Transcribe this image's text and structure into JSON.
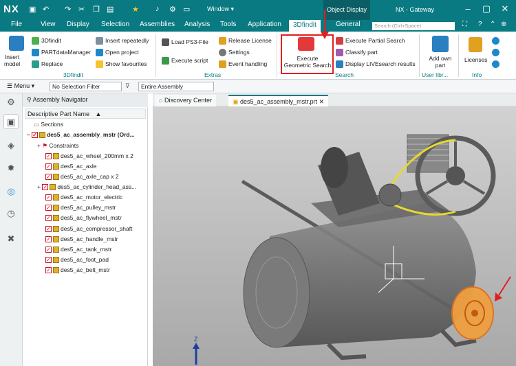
{
  "app": {
    "logo": "NX",
    "window_menu": "Window",
    "context_tab": "Object Display",
    "title": "NX - Gateway"
  },
  "menu": {
    "items": [
      "File",
      "View",
      "Display",
      "Selection",
      "Assemblies",
      "Analysis",
      "Tools",
      "Application",
      "3Dfindit",
      "General"
    ],
    "search_placeholder": "Search (Ctrl+Space)"
  },
  "ribbon": {
    "find": {
      "insert_model": "Insert\nmodel",
      "threedfindit": "3Dfindit",
      "partdata": "PARTdataManager",
      "replace": "Replace",
      "insert_rep": "Insert repeatedly",
      "open_project": "Open project",
      "show_fav": "Show favourites",
      "group": "3Dfindit"
    },
    "extras": {
      "load_ps3": "Load PS3-File",
      "execute_script": "Execute script",
      "release_license": "Release License",
      "settings": "Settings",
      "event_handling": "Event handling",
      "group": "Extras"
    },
    "search": {
      "execute_geo": "Execute Geometric Search",
      "execute_partial": "Execute Partial Search",
      "classify": "Classify part",
      "display_live": "Display LIVEsearch results",
      "group": "Search"
    },
    "userlib": {
      "add_own": "Add own part",
      "group": "User libr..."
    },
    "info": {
      "licenses": "Licenses",
      "group": "Info"
    }
  },
  "toolbar": {
    "menu": "Menu",
    "selection_filter": "No Selection Filter",
    "scope": "Entire Assembly"
  },
  "navigator": {
    "title": "Assembly Navigator",
    "column": "Descriptive Part Name",
    "items": [
      "Sections",
      "des5_ac_assembly_mstr (Ord...",
      "Constraints",
      "des5_ac_wheel_200mm x 2",
      "des5_ac_axle",
      "des5_ac_axle_cap x 2",
      "des5_ac_cylinder_head_ass...",
      "des5_ac_motor_electric",
      "des5_ac_pulley_mstr",
      "des5_ac_flywheel_mstr",
      "des5_ac_compressor_shaft",
      "des5_ac_handle_mstr",
      "des5_ac_tank_mstr",
      "des5_ac_foot_pad",
      "des5_ac_belt_mstr"
    ]
  },
  "viewport": {
    "tabs": [
      "Discovery Center",
      "des5_ac_assembly_mstr.prt"
    ],
    "axis_z": "Z"
  }
}
